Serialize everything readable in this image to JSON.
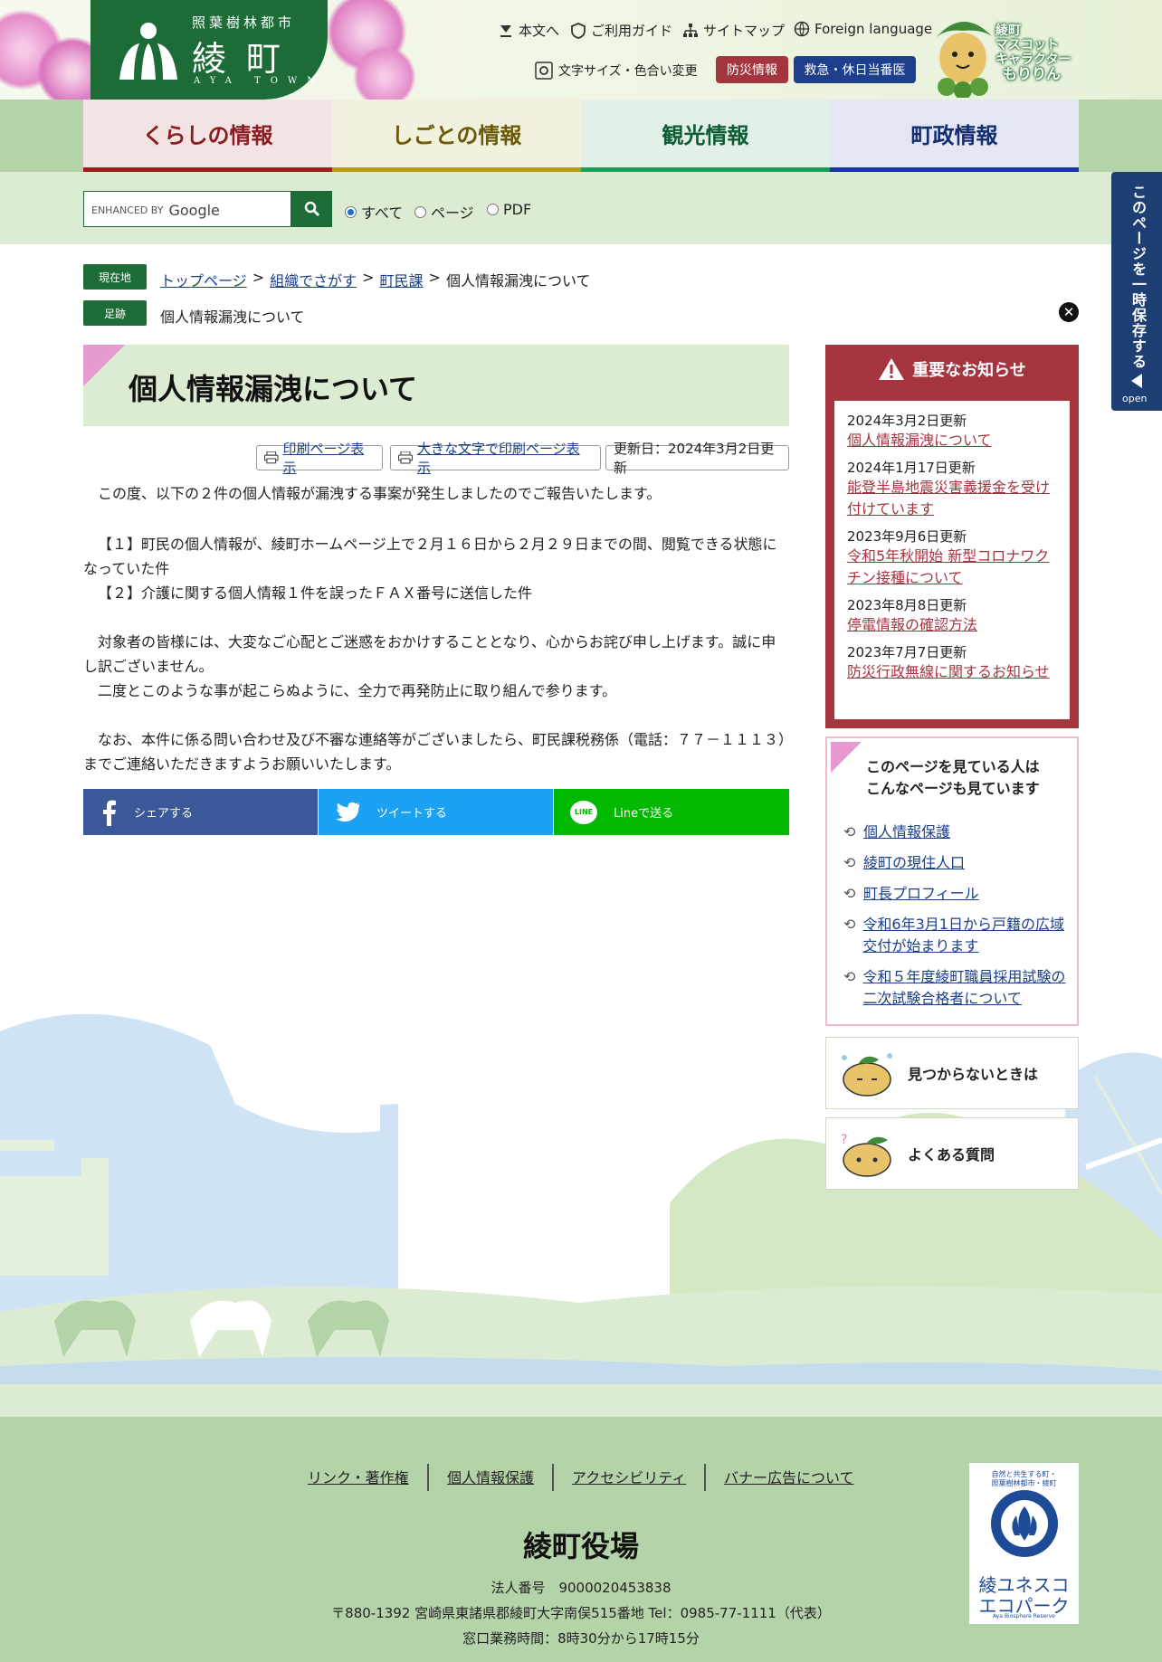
{
  "header": {
    "logo_top": "照葉樹林都市",
    "logo_main": "綾町",
    "logo_sub": "AYA TOWN",
    "util_links": [
      "本文へ",
      "ご利用ガイド",
      "サイトマップ",
      "Foreign language"
    ],
    "text_size_label": "文字サイズ・色合い変更",
    "disaster_label": "防災情報",
    "emergency_label": "救急・休日当番医",
    "mascot_lines": [
      "綾町",
      "マスコット",
      "キャラクター",
      "もりりん"
    ],
    "colors": {
      "brand_green": "#1d6b36",
      "disaster_red": "#a4343e",
      "emergency_blue": "#1e3f8b"
    }
  },
  "nav": {
    "tabs": [
      {
        "label": "くらしの情報",
        "color": "#8b1c22",
        "bg": "#f3e3e3",
        "border": "#b0121b"
      },
      {
        "label": "しごとの情報",
        "color": "#6b5a0a",
        "bg": "#f2f1dd",
        "border": "#b59d10"
      },
      {
        "label": "観光情報",
        "color": "#0e5c33",
        "bg": "#e2f1e8",
        "border": "#1b9d54"
      },
      {
        "label": "町政情報",
        "color": "#142c70",
        "bg": "#e3e7f3",
        "border": "#1a34a8"
      }
    ]
  },
  "search": {
    "brand_prefix": "ENHANCED BY",
    "brand_name": "Google",
    "options": [
      "すべて",
      "ページ",
      "PDF"
    ],
    "selected": "すべて"
  },
  "side_tab": {
    "label": "このページを一時保存する",
    "open": "open"
  },
  "breadcrumb": {
    "current_tag": "現在地",
    "items": [
      "トップページ",
      "組織でさがす",
      "町民課"
    ],
    "current": "個人情報漏洩について",
    "trail_tag": "足跡",
    "trail_item": "個人情報漏洩について"
  },
  "article": {
    "title": "個人情報漏洩について",
    "print_label": "印刷ページ表示",
    "print_large_label": "大きな文字で印刷ページ表示",
    "updated": "更新日：2024年3月2日更新",
    "paragraphs": [
      "この度、以下の２件の個人情報が漏洩する事案が発生しましたのでご報告いたします。",
      "【１】町民の個人情報が、綾町ホームページ上で２月１６日から２月２９日までの間、閲覧できる状態になっていた件",
      "【２】介護に関する個人情報１件を誤ったＦＡＸ番号に送信した件",
      "対象者の皆様には、大変なご心配とご迷惑をおかけすることとなり、心からお詫び申し上げます。誠に申し訳ございません。",
      "二度とこのような事が起こらぬように、全力で再発防止に取り組んで参ります。",
      "なお、本件に係る問い合わせ及び不審な連絡等がございましたら、町民課税務係（電話：７７－１１１３）までご連絡いただきますようお願いいたします。"
    ]
  },
  "share": {
    "facebook": "シェアする",
    "twitter": "ツイートする",
    "line_badge": "LINE",
    "line": "Lineで送る",
    "colors": {
      "facebook": "#3b5998",
      "twitter": "#1da1f2",
      "line": "#00b900"
    }
  },
  "notice": {
    "title": "重要なお知らせ",
    "items": [
      {
        "date": "2024年3月2日更新",
        "label": "個人情報漏洩について"
      },
      {
        "date": "2024年1月17日更新",
        "label": "能登半島地震災害義援金を受け付けています"
      },
      {
        "date": "2023年9月6日更新",
        "label": "令和5年秋開始 新型コロナワクチン接種について"
      },
      {
        "date": "2023年8月8日更新",
        "label": "停電情報の確認方法"
      },
      {
        "date": "2023年7月7日更新",
        "label": "防災行政無線に関するお知らせ"
      }
    ]
  },
  "also_viewed": {
    "title": "このページを見ている人は\nこんなページも見ています",
    "items": [
      "個人情報保護",
      "綾町の現住人口",
      "町長プロフィール",
      "令和6年3月1日から戸籍の広域交付が始まります",
      "令和５年度綾町職員採用試験の二次試験合格者について"
    ]
  },
  "help": {
    "not_found": "見つからないときは",
    "faq": "よくある質問"
  },
  "footer": {
    "links": [
      "リンク・著作権",
      "個人情報保護",
      "アクセシビリティ",
      "バナー広告について"
    ],
    "org_name": "綾町役場",
    "corp_no": "法人番号　9000020453838",
    "address": "〒880-1392 宮崎県東諸県郡綾町大字南俣515番地 Tel：0985-77-1111（代表）",
    "hours": "窓口業務時間：8時30分から17時15分",
    "eco_top": "自然と共生する町・\n照葉樹林都市・綾町",
    "eco_name": "綾ユネスコ\nエコパーク",
    "eco_en": "Aya Biosphere Reserve"
  }
}
